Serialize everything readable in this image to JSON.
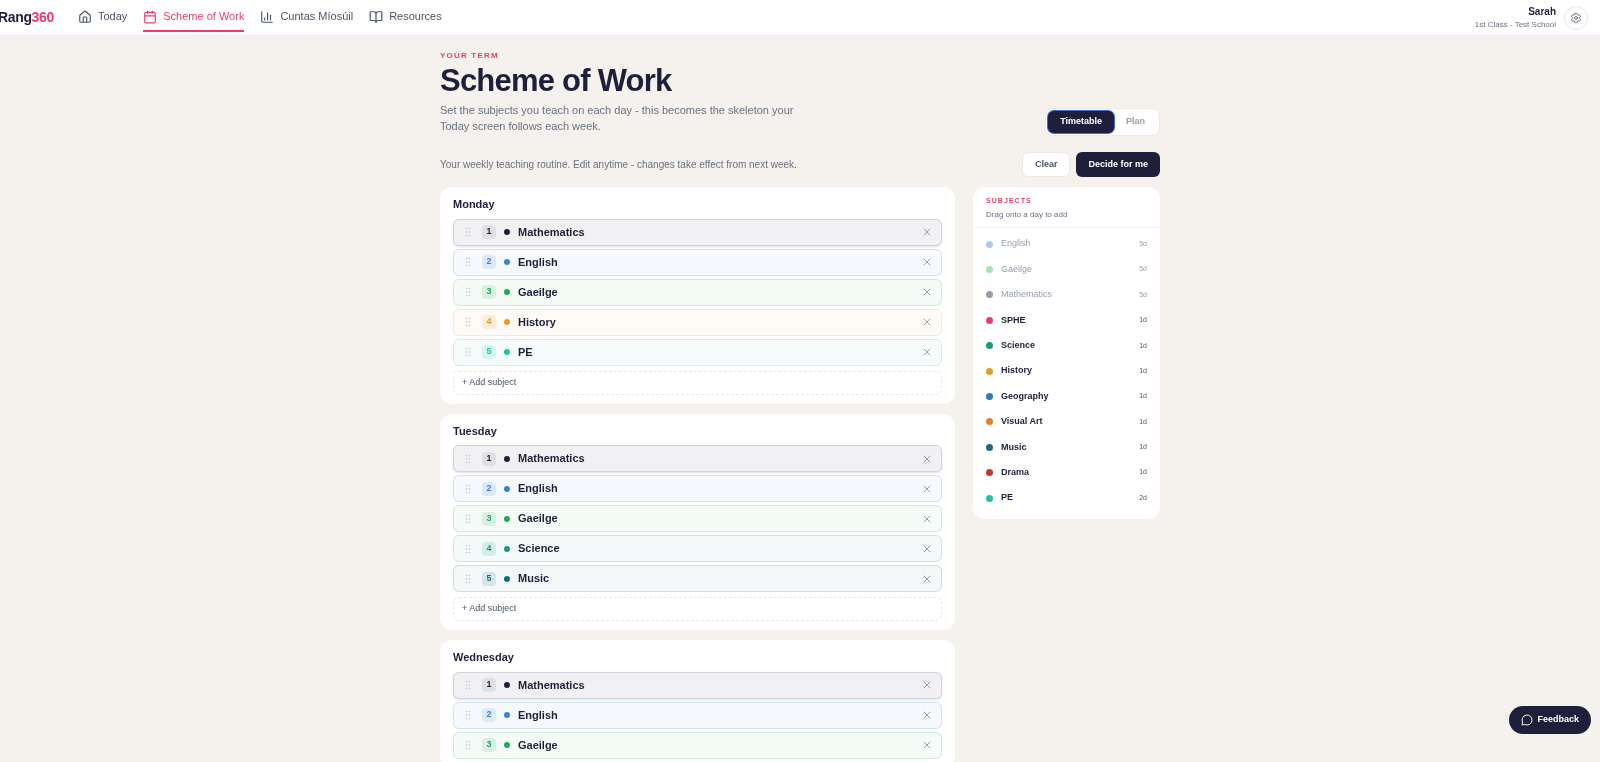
{
  "nav": {
    "logo": {
      "text": "Rang",
      "accent": "360"
    },
    "items": [
      {
        "label": "Today",
        "selected": false
      },
      {
        "label": "Scheme of Work",
        "selected": true
      },
      {
        "label": "Cuntas Míosúil",
        "selected": false
      },
      {
        "label": "Resources",
        "selected": false
      }
    ],
    "user": {
      "name": "Sarah",
      "subtitle": "1st Class - Test School"
    }
  },
  "header": {
    "eyebrow": "YOUR TERM",
    "title": "Scheme of Work",
    "description": "Set the subjects you teach on each day - this becomes the skeleton your Today screen follows each week.",
    "view_toggle": [
      {
        "label": "Timetable",
        "selected": true
      },
      {
        "label": "Plan",
        "selected": false
      }
    ],
    "note": "Your weekly teaching routine. Edit anytime - changes take effect from next week.",
    "buttons": [
      {
        "label": "Clear",
        "kind": "secondary"
      },
      {
        "label": "Decide for me",
        "kind": "primary"
      }
    ]
  },
  "days": [
    {
      "name": "Monday",
      "add_label": "+ Add subject",
      "subjects": [
        {
          "number": "1",
          "name": "Mathematics",
          "color": "#1e1f3b",
          "selected": true
        },
        {
          "number": "2",
          "name": "English",
          "color": "#3b82d6",
          "selected": false
        },
        {
          "number": "3",
          "name": "Gaeilge",
          "color": "#22a85a",
          "selected": false
        },
        {
          "number": "4",
          "name": "History",
          "color": "#e89a2c",
          "selected": false
        },
        {
          "number": "5",
          "name": "PE",
          "color": "#22c3a0",
          "selected": false
        }
      ]
    },
    {
      "name": "Tuesday",
      "add_label": "+ Add subject",
      "subjects": [
        {
          "number": "1",
          "name": "Mathematics",
          "color": "#1e1f3b",
          "selected": true
        },
        {
          "number": "2",
          "name": "English",
          "color": "#3b82d6",
          "selected": false
        },
        {
          "number": "3",
          "name": "Gaeilge",
          "color": "#22a85a",
          "selected": false
        },
        {
          "number": "4",
          "name": "Science",
          "color": "#1a9a7a",
          "selected": false
        },
        {
          "number": "5",
          "name": "Music",
          "color": "#1a6a80",
          "selected": false
        }
      ]
    },
    {
      "name": "Wednesday",
      "subjects": [
        {
          "number": "1",
          "name": "Mathematics",
          "color": "#1e1f3b",
          "selected": true
        },
        {
          "number": "2",
          "name": "English",
          "color": "#3b82d6",
          "selected": false
        },
        {
          "number": "3",
          "name": "Gaeilge",
          "color": "#22a85a",
          "selected": false
        }
      ]
    }
  ],
  "subjects_panel": {
    "title": "SUBJECTS",
    "hint": "Drag onto a day to add",
    "items": [
      {
        "name": "English",
        "count": "5d",
        "color": "#a9cdf0",
        "disabled": true
      },
      {
        "name": "Gaeilge",
        "count": "5d",
        "color": "#a8e0bc",
        "disabled": true
      },
      {
        "name": "Mathematics",
        "count": "5d",
        "color": "#9a9aa8",
        "disabled": true
      },
      {
        "name": "SPHE",
        "count": "1d",
        "color": "#e83e6a",
        "disabled": false
      },
      {
        "name": "Science",
        "count": "1d",
        "color": "#1a9a7a",
        "disabled": false
      },
      {
        "name": "History",
        "count": "1d",
        "color": "#e89a2c",
        "disabled": false
      },
      {
        "name": "Geography",
        "count": "1d",
        "color": "#2a7ac0",
        "disabled": false
      },
      {
        "name": "Visual Art",
        "count": "1d",
        "color": "#e8802a",
        "disabled": false
      },
      {
        "name": "Music",
        "count": "1d",
        "color": "#1a6a80",
        "disabled": false
      },
      {
        "name": "Drama",
        "count": "1d",
        "color": "#c03a2a",
        "disabled": false
      },
      {
        "name": "PE",
        "count": "2d",
        "color": "#22c3a0",
        "disabled": false
      }
    ]
  },
  "feedback": {
    "label": "Feedback"
  }
}
